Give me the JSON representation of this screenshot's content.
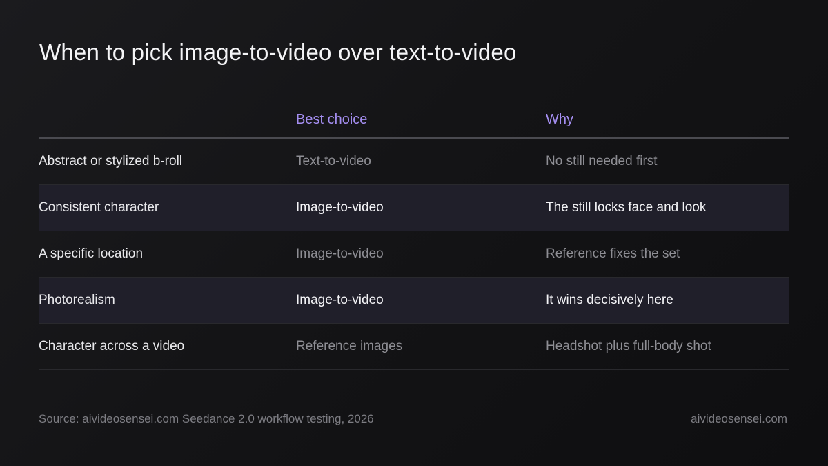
{
  "title": "When to pick image-to-video over text-to-video",
  "table": {
    "headers": [
      "",
      "Best choice",
      "Why"
    ],
    "rows": [
      {
        "label": "Abstract or stylized b-roll",
        "choice": "Text-to-video",
        "why": "No still needed first",
        "highlight": false
      },
      {
        "label": "Consistent character",
        "choice": "Image-to-video",
        "why": "The still locks face and look",
        "highlight": true
      },
      {
        "label": "A specific location",
        "choice": "Image-to-video",
        "why": "Reference fixes the set",
        "highlight": false
      },
      {
        "label": "Photorealism",
        "choice": "Image-to-video",
        "why": "It wins decisively here",
        "highlight": true
      },
      {
        "label": "Character across a video",
        "choice": "Reference images",
        "why": "Headshot plus full-body shot",
        "highlight": false
      }
    ]
  },
  "footer": {
    "source": "Source: aivideosensei.com Seedance 2.0 workflow testing, 2026",
    "site": "aivideosensei.com"
  },
  "colors": {
    "accent": "#a48ef0",
    "highlight_row": "#201f2a",
    "background": "#141416"
  }
}
